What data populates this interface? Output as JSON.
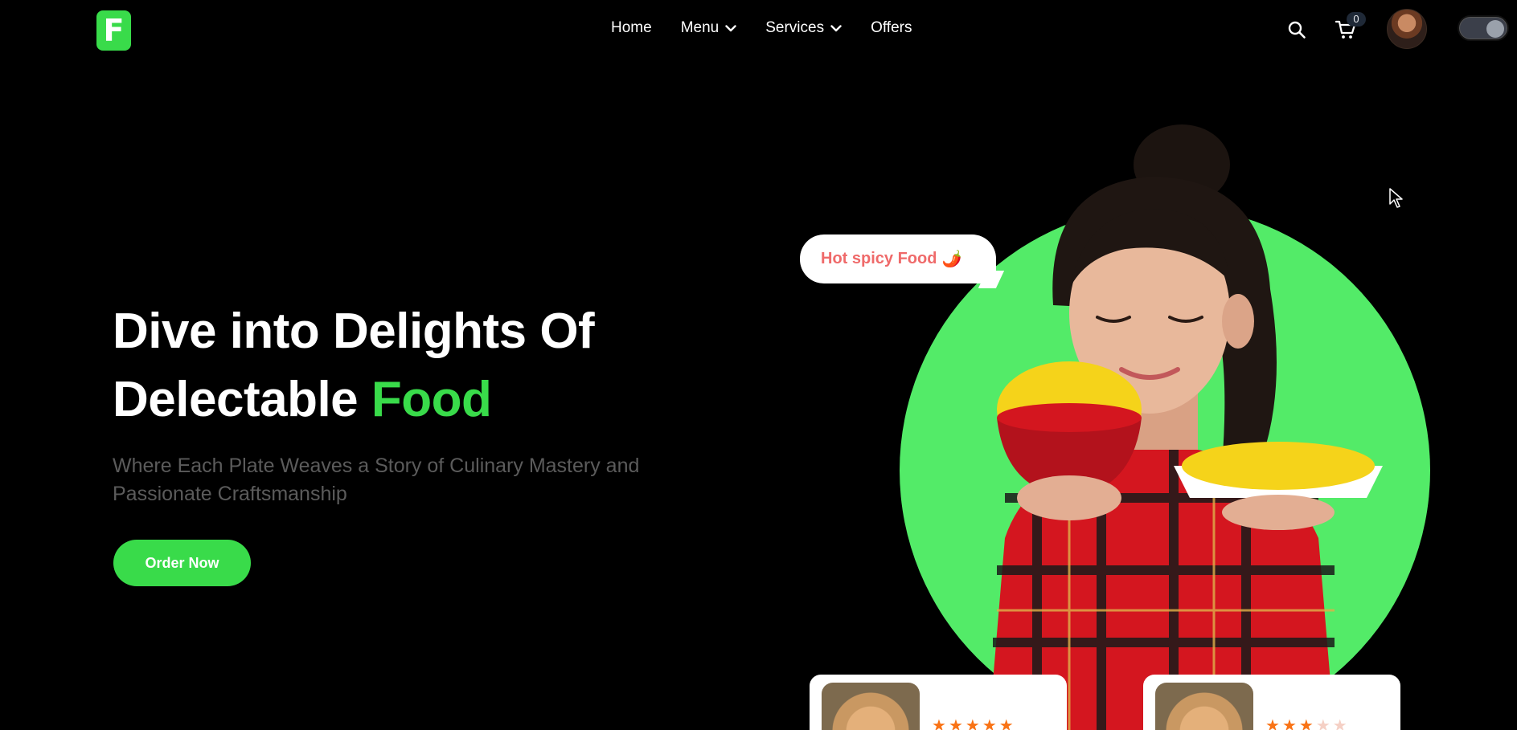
{
  "brand": {
    "logo_letter": "F",
    "accent_color": "#39db4a"
  },
  "nav": {
    "links": [
      {
        "label": "Home",
        "has_dropdown": false
      },
      {
        "label": "Menu",
        "has_dropdown": true
      },
      {
        "label": "Services",
        "has_dropdown": true
      },
      {
        "label": "Offers",
        "has_dropdown": false
      }
    ],
    "cart_count": "0",
    "icons": [
      "search-icon",
      "cart-icon"
    ],
    "theme_toggle": {
      "state": "on"
    }
  },
  "hero": {
    "headline_line1": "Dive into Delights Of",
    "headline_line2_prefix": "Delectable ",
    "headline_accent": "Food",
    "subheading": "Where Each Plate Weaves a Story of Culinary Mastery and Passionate Craftsmanship",
    "cta_label": "Order Now",
    "bubble_text": "Hot spicy Food",
    "bubble_emoji": "🌶️"
  },
  "cards": [
    {
      "rating": 5,
      "max_rating": 5
    },
    {
      "rating": 3,
      "max_rating": 5
    }
  ],
  "colors": {
    "background": "#000000",
    "accent": "#39db4a",
    "hero_circle": "#53eb68",
    "bubble_text": "#ef6a6a",
    "star": "#f97316"
  }
}
